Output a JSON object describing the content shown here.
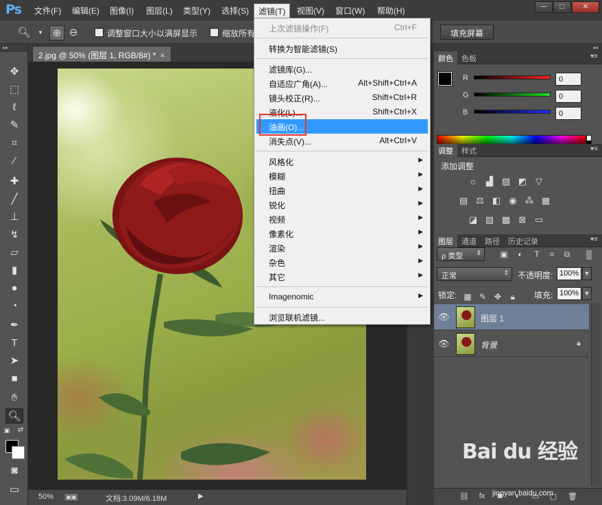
{
  "menubar": {
    "logo": "Ps",
    "items": [
      "文件(F)",
      "编辑(E)",
      "图像(I)",
      "图层(L)",
      "类型(Y)",
      "选择(S)",
      "滤镜(T)",
      "视图(V)",
      "窗口(W)",
      "帮助(H)"
    ],
    "active_index": 6,
    "win_minimize": "─",
    "win_maximize": "□",
    "win_close": "✕"
  },
  "options": {
    "tool_icon": "zoom-icon",
    "resize_windows_label": "调整窗口大小以满屏显示",
    "zoom_all_label": "缩放所有",
    "fill_screen_button": "填充屏幕"
  },
  "document": {
    "tab_title": "2.jpg @ 50% (图层 1, RGB/8#) *",
    "tab_close": "×",
    "status_zoom": "50%",
    "status_doc": "文档:3.09M/6.18M",
    "status_arrow": "▶"
  },
  "filter_menu": {
    "items": [
      {
        "label": "上次滤镜操作(F)",
        "shortcut": "Ctrl+F",
        "disabled": true
      },
      {
        "label": "转换为智能滤镜(S)"
      },
      {
        "label": "滤镜库(G)..."
      },
      {
        "label": "自适应广角(A)...",
        "shortcut": "Alt+Shift+Ctrl+A"
      },
      {
        "label": "镜头校正(R)...",
        "shortcut": "Shift+Ctrl+R"
      },
      {
        "label": "液化(L)...",
        "shortcut": "Shift+Ctrl+X"
      },
      {
        "label": "油画(O)...",
        "highlighted": true
      },
      {
        "label": "消失点(V)...",
        "shortcut": "Alt+Ctrl+V"
      },
      {
        "label": "风格化",
        "submenu": true
      },
      {
        "label": "模糊",
        "submenu": true
      },
      {
        "label": "扭曲",
        "submenu": true
      },
      {
        "label": "锐化",
        "submenu": true
      },
      {
        "label": "视频",
        "submenu": true
      },
      {
        "label": "像素化",
        "submenu": true
      },
      {
        "label": "渲染",
        "submenu": true
      },
      {
        "label": "杂色",
        "submenu": true
      },
      {
        "label": "其它",
        "submenu": true
      },
      {
        "label": "Imagenomic",
        "submenu": true
      },
      {
        "label": "浏览联机滤镜..."
      }
    ],
    "submenu_glyph": "▶"
  },
  "color_panel": {
    "tabs": [
      "颜色",
      "色板"
    ],
    "channels": [
      {
        "label": "R",
        "value": "0",
        "color": "#ff2020"
      },
      {
        "label": "G",
        "value": "0",
        "color": "#20e020"
      },
      {
        "label": "B",
        "value": "0",
        "color": "#2030ff"
      }
    ],
    "foreground": "#000000",
    "background": "#ffffff"
  },
  "adjustments_panel": {
    "tabs": [
      "调整",
      "样式"
    ],
    "title": "添加调整"
  },
  "layers_panel": {
    "tabs": [
      "图层",
      "通道",
      "路径",
      "历史记录"
    ],
    "filter_kind": "ρ 类型",
    "blend_mode": "正常",
    "opacity_label": "不透明度:",
    "opacity_value": "100%",
    "lock_label": "锁定:",
    "fill_label": "填充:",
    "fill_value": "100%",
    "layers": [
      {
        "name": "图层 1",
        "selected": true,
        "locked": false
      },
      {
        "name": "背景",
        "selected": false,
        "locked": true
      }
    ]
  },
  "watermark": {
    "logo": "Bai du 经验",
    "url": "jingyan.baidu.com"
  },
  "colors": {
    "menu_highlight": "#3399ff",
    "selected_layer": "#6f7f98",
    "annotation_box": "#e3342f"
  }
}
